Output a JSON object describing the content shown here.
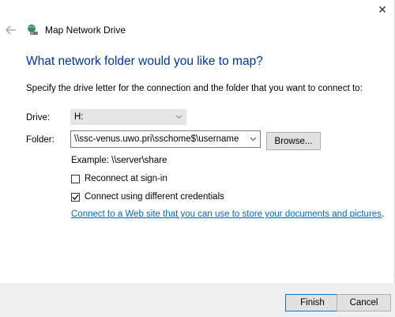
{
  "window": {
    "close_glyph": "✕",
    "app_title": "Map Network Drive",
    "icons": {
      "back": "back-arrow-icon",
      "app": "network-drive-icon",
      "close": "close-icon"
    }
  },
  "heading": "What network folder would you like to map?",
  "instructions": "Specify the drive letter for the connection and the folder that you want to connect to:",
  "drive": {
    "label": "Drive:",
    "value": "H:"
  },
  "folder": {
    "label": "Folder:",
    "value": "\\\\ssc-venus.uwo.pri\\sschome$\\username",
    "browse_label": "Browse..."
  },
  "example": "Example: \\\\server\\share",
  "options": [
    {
      "label": "Reconnect at sign-in",
      "checked": false
    },
    {
      "label": "Connect using different credentials",
      "checked": true
    }
  ],
  "link_text": "Connect to a Web site that you can use to store your documents and pictures",
  "link_suffix": ".",
  "buttons": {
    "finish": "Finish",
    "cancel": "Cancel"
  },
  "colors": {
    "heading": "#003399",
    "link": "#0066cc",
    "footer_bg": "#f0f0f0"
  }
}
